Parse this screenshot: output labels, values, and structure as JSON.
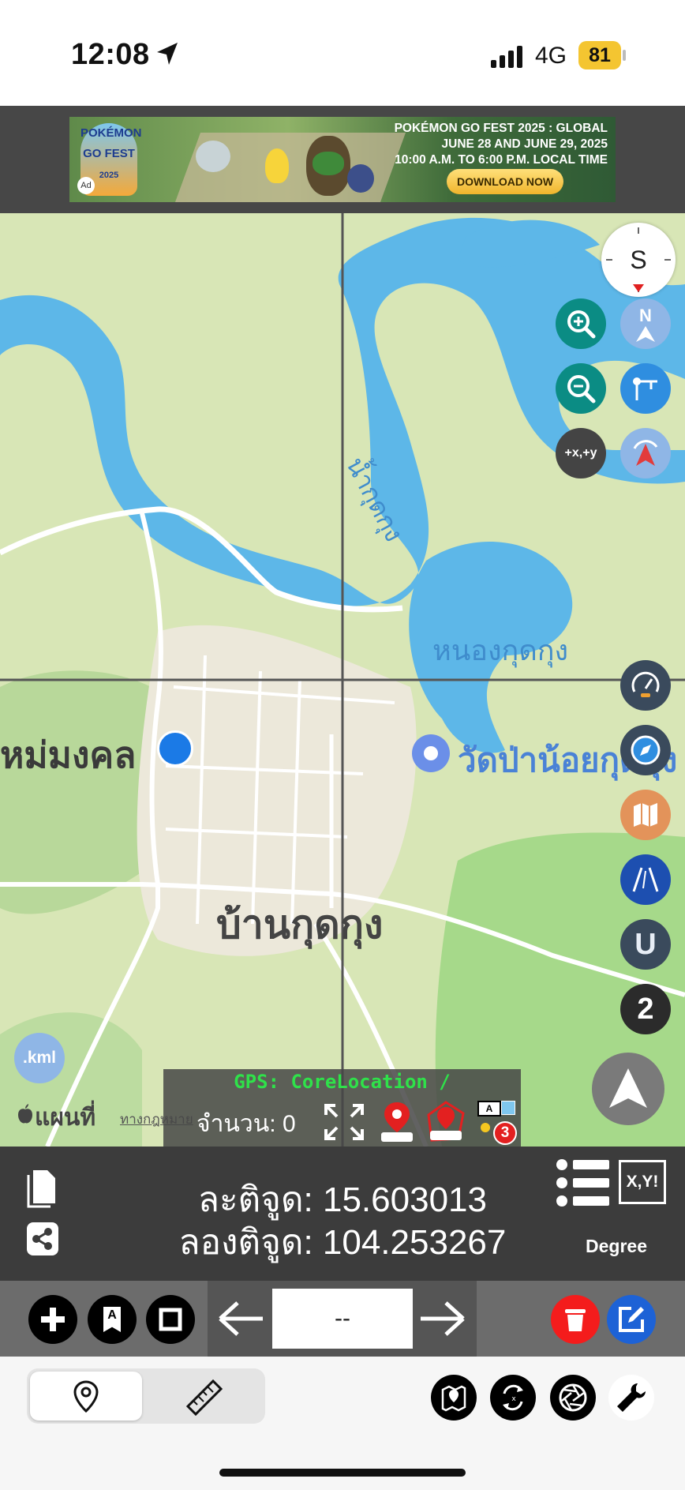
{
  "status_bar": {
    "time": "12:08",
    "network": "4G",
    "battery": "81"
  },
  "ad": {
    "logo_text": "POKÉMON GO FEST",
    "logo_year": "2025",
    "ad_tag": "Ad",
    "line1": "POKÉMON GO FEST 2025 : GLOBAL",
    "line2": "JUNE 28 AND JUNE 29, 2025",
    "line3": "10:00 A.M. TO 6:00 P.M. LOCAL TIME",
    "button": "DOWNLOAD NOW"
  },
  "map": {
    "labels": {
      "river": "น้ำกุดกุง",
      "pond": "หนองกุดกุง",
      "village_west": "หม่มงคล",
      "temple": "วัดป่าน้อยกุดกุง",
      "village": "บ้านกุดกุง"
    },
    "attribution": {
      "brand": "แผนที่",
      "legal": "ทางกฎหมาย"
    },
    "controls": {
      "compass_letter": "S",
      "north_letter": "N",
      "coord_btn": "+x,+y",
      "kml_btn": ".kml",
      "magnet_letter": "U",
      "count_badge": "2"
    }
  },
  "gps_panel": {
    "title": "GPS: CoreLocation /",
    "count": "จำนวน: 0",
    "badge_count": "3",
    "badge_letter": "A"
  },
  "coords": {
    "lat": "ละติจูด: 15.603013",
    "lon": "ลองติจูด: 104.253267",
    "xy_btn": "X,Y!",
    "unit": "Degree"
  },
  "toolbar": {
    "page_value": "--",
    "text_btn": "A"
  },
  "colors": {
    "map_green": "#d8e6b6",
    "water": "#5db7e8",
    "teal_btn": "#0b8c84",
    "blue_btn": "#2f8ee0",
    "delete_red": "#f41c1c",
    "edit_blue": "#1d62d6",
    "gps_green": "#2fe24a"
  }
}
